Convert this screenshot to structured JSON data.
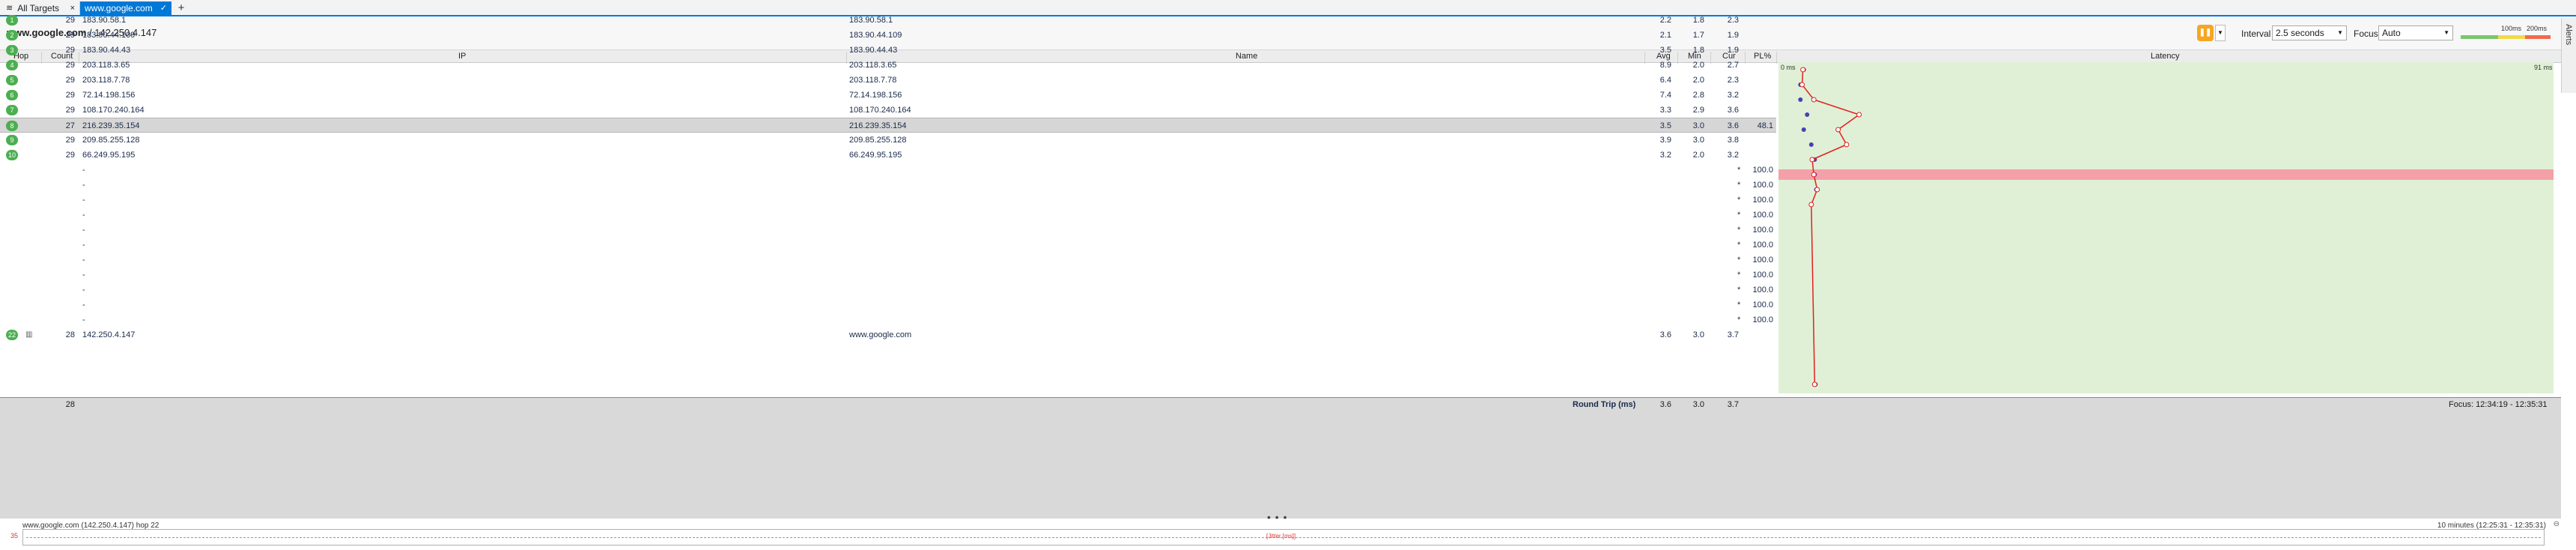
{
  "tabs": [
    {
      "label": "All Targets",
      "icon": "pulse-icon",
      "close": "×"
    },
    {
      "label": "www.google.com",
      "icon": "chevron-down-icon",
      "close": "×"
    }
  ],
  "tab_add": "+",
  "toolbar": {
    "breadcrumb_target": "www.google.com",
    "breadcrumb_ip": " / 142.250.4.147",
    "interval_label": "Interval",
    "interval_value": "2.5 seconds",
    "focus_label": "Focus",
    "focus_value": "Auto",
    "scale_labels": [
      "100ms",
      "200ms"
    ],
    "alerts_label": "Alerts"
  },
  "columns": {
    "hop": "Hop",
    "count": "Count",
    "ip": "IP",
    "name": "Name",
    "avg": "Avg",
    "min": "Min",
    "cur": "Cur",
    "pl": "PL%",
    "latency": "Latency",
    "latency_min": "0 ms",
    "latency_max": "91 ms"
  },
  "hops": [
    {
      "hop": "1",
      "count": "29",
      "ip": "183.90.58.1",
      "name": "183.90.58.1",
      "avg": "2.2",
      "min": "1.8",
      "cur": "2.3",
      "pl": ""
    },
    {
      "hop": "2",
      "count": "29",
      "ip": "183.90.44.109",
      "name": "183.90.44.109",
      "avg": "2.1",
      "min": "1.7",
      "cur": "1.9",
      "pl": ""
    },
    {
      "hop": "3",
      "count": "29",
      "ip": "183.90.44.43",
      "name": "183.90.44.43",
      "avg": "3.5",
      "min": "1.8",
      "cur": "1.9",
      "pl": ""
    },
    {
      "hop": "4",
      "count": "29",
      "ip": "203.118.3.65",
      "name": "203.118.3.65",
      "avg": "8.9",
      "min": "2.0",
      "cur": "2.7",
      "pl": ""
    },
    {
      "hop": "5",
      "count": "29",
      "ip": "203.118.7.78",
      "name": "203.118.7.78",
      "avg": "6.4",
      "min": "2.0",
      "cur": "2.3",
      "pl": ""
    },
    {
      "hop": "6",
      "count": "29",
      "ip": "72.14.198.156",
      "name": "72.14.198.156",
      "avg": "7.4",
      "min": "2.8",
      "cur": "3.2",
      "pl": ""
    },
    {
      "hop": "7",
      "count": "29",
      "ip": "108.170.240.164",
      "name": "108.170.240.164",
      "avg": "3.3",
      "min": "2.9",
      "cur": "3.6",
      "pl": ""
    },
    {
      "hop": "8",
      "count": "27",
      "ip": "216.239.35.154",
      "name": "216.239.35.154",
      "avg": "3.5",
      "min": "3.0",
      "cur": "3.6",
      "pl": "48.1"
    },
    {
      "hop": "9",
      "count": "29",
      "ip": "209.85.255.128",
      "name": "209.85.255.128",
      "avg": "3.9",
      "min": "3.0",
      "cur": "3.8",
      "pl": ""
    },
    {
      "hop": "10",
      "count": "29",
      "ip": "66.249.95.195",
      "name": "66.249.95.195",
      "avg": "3.2",
      "min": "2.0",
      "cur": "3.2",
      "pl": ""
    }
  ],
  "timeout_rows": [
    {
      "ip": "-",
      "cur": "*",
      "pl": "100.0"
    },
    {
      "ip": "-",
      "cur": "*",
      "pl": "100.0"
    },
    {
      "ip": "-",
      "cur": "*",
      "pl": "100.0"
    },
    {
      "ip": "-",
      "cur": "*",
      "pl": "100.0"
    },
    {
      "ip": "-",
      "cur": "*",
      "pl": "100.0"
    },
    {
      "ip": "-",
      "cur": "*",
      "pl": "100.0"
    },
    {
      "ip": "-",
      "cur": "*",
      "pl": "100.0"
    },
    {
      "ip": "-",
      "cur": "*",
      "pl": "100.0"
    },
    {
      "ip": "-",
      "cur": "*",
      "pl": "100.0"
    },
    {
      "ip": "-",
      "cur": "*",
      "pl": "100.0"
    },
    {
      "ip": "-",
      "cur": "*",
      "pl": "100.0"
    }
  ],
  "final_hop": {
    "hop": "22",
    "count": "28",
    "ip": "142.250.4.147",
    "name": "www.google.com",
    "avg": "3.6",
    "min": "3.0",
    "cur": "3.7",
    "pl": ""
  },
  "summary": {
    "count": "28",
    "label": "Round Trip (ms)",
    "avg": "3.6",
    "min": "3.0",
    "cur": "3.7",
    "focus_range": "Focus: 12:34:19 - 12:35:31"
  },
  "timeline": {
    "title": "www.google.com (142.250.4.147) hop 22",
    "range": "10 minutes (12:25:31 - 12:35:31)",
    "y_label": "35",
    "jitter_label": "[Jitter [ms]]",
    "dots": "• • •"
  },
  "colors": {
    "accent": "#0078d7",
    "hop_badge": "#4caf50",
    "latency_bg": "#e0f0d6",
    "loss_bar": "#f4a0a8",
    "trace_line": "#e02020"
  }
}
